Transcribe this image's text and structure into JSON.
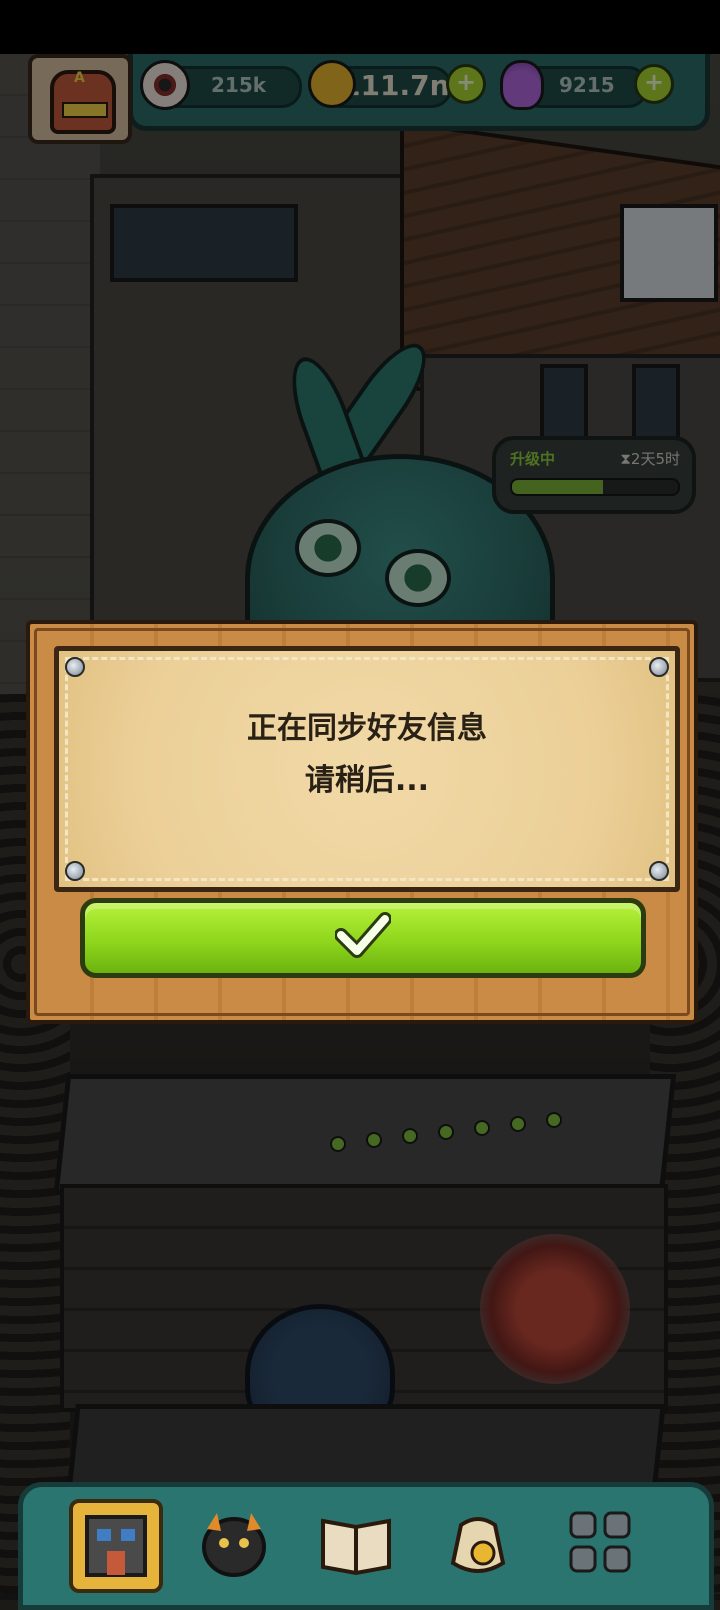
{
  "hud": {
    "avatar_letter": "A",
    "eyes_count": "215k",
    "coins_count": "111.7n",
    "potions_count": "9215"
  },
  "upgrade": {
    "label": "升级中",
    "time": "⧗2天5时",
    "progress": 0.55
  },
  "dialog": {
    "line1": "正在同步好友信息",
    "line2": "请稍后..."
  },
  "bottom_nav": {
    "items": [
      "building",
      "monster",
      "book",
      "coin-bag",
      "grid"
    ],
    "selected": "building"
  }
}
